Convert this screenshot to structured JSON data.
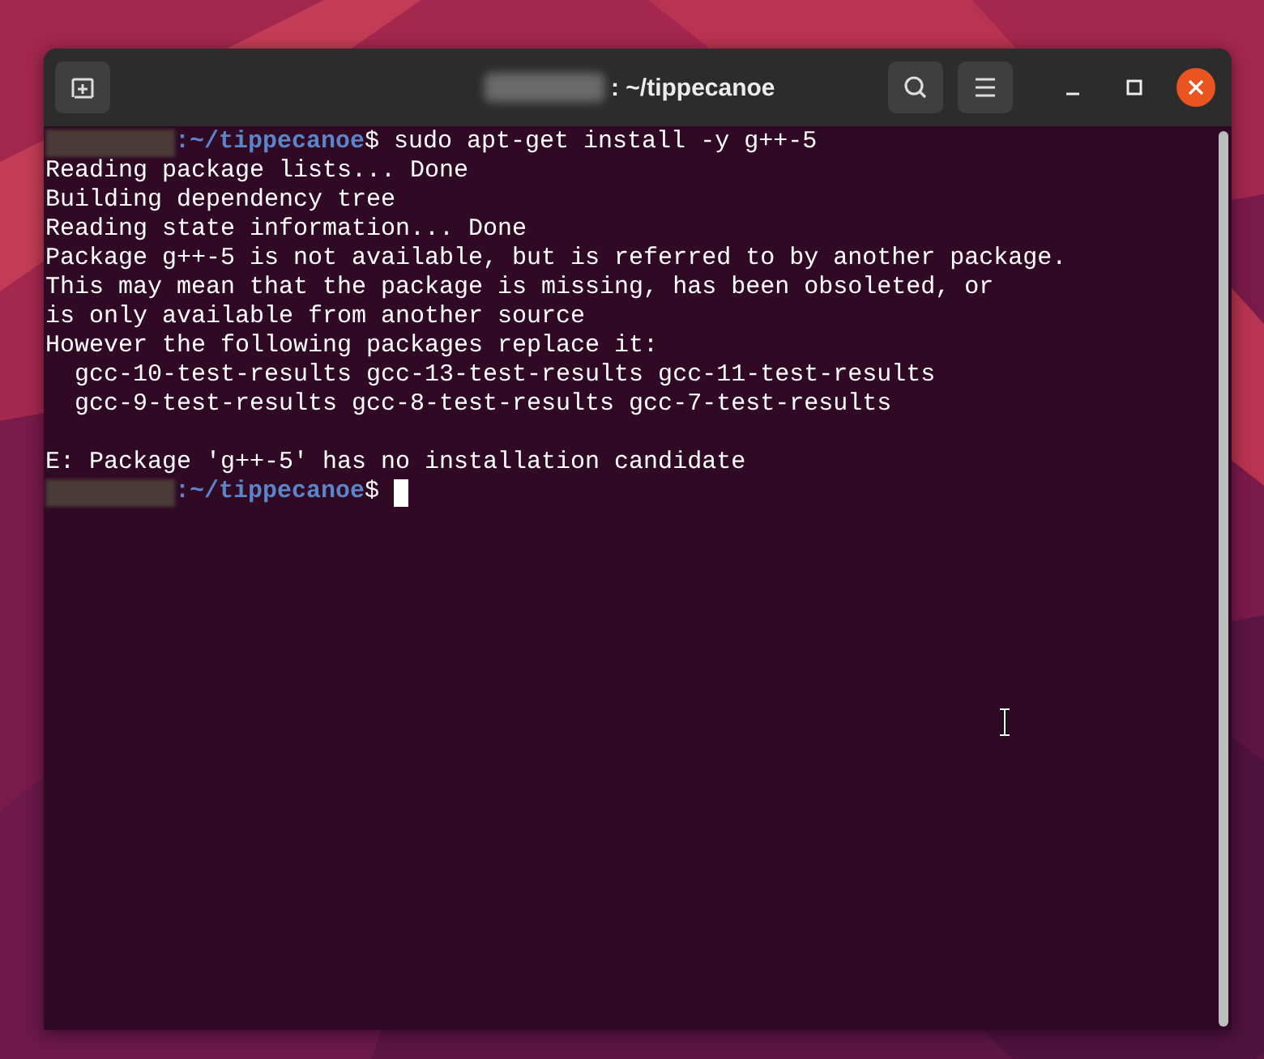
{
  "window": {
    "title": ": ~/tippecanoe"
  },
  "terminal": {
    "lines": [
      {
        "kind": "prompt",
        "path": ":~/tippecanoe",
        "command": "$ sudo apt-get install -y g++-5"
      },
      {
        "kind": "output",
        "text": "Reading package lists... Done"
      },
      {
        "kind": "output",
        "text": "Building dependency tree"
      },
      {
        "kind": "output",
        "text": "Reading state information... Done"
      },
      {
        "kind": "output",
        "text": "Package g++-5 is not available, but is referred to by another package."
      },
      {
        "kind": "output",
        "text": "This may mean that the package is missing, has been obsoleted, or"
      },
      {
        "kind": "output",
        "text": "is only available from another source"
      },
      {
        "kind": "output",
        "text": "However the following packages replace it:"
      },
      {
        "kind": "output",
        "text": "  gcc-10-test-results gcc-13-test-results gcc-11-test-results"
      },
      {
        "kind": "output",
        "text": "  gcc-9-test-results gcc-8-test-results gcc-7-test-results"
      },
      {
        "kind": "blank"
      },
      {
        "kind": "output",
        "text": "E: Package 'g++-5' has no installation candidate"
      },
      {
        "kind": "prompt",
        "path": ":~/tippecanoe",
        "command": "$ ",
        "cursor": true
      }
    ]
  }
}
